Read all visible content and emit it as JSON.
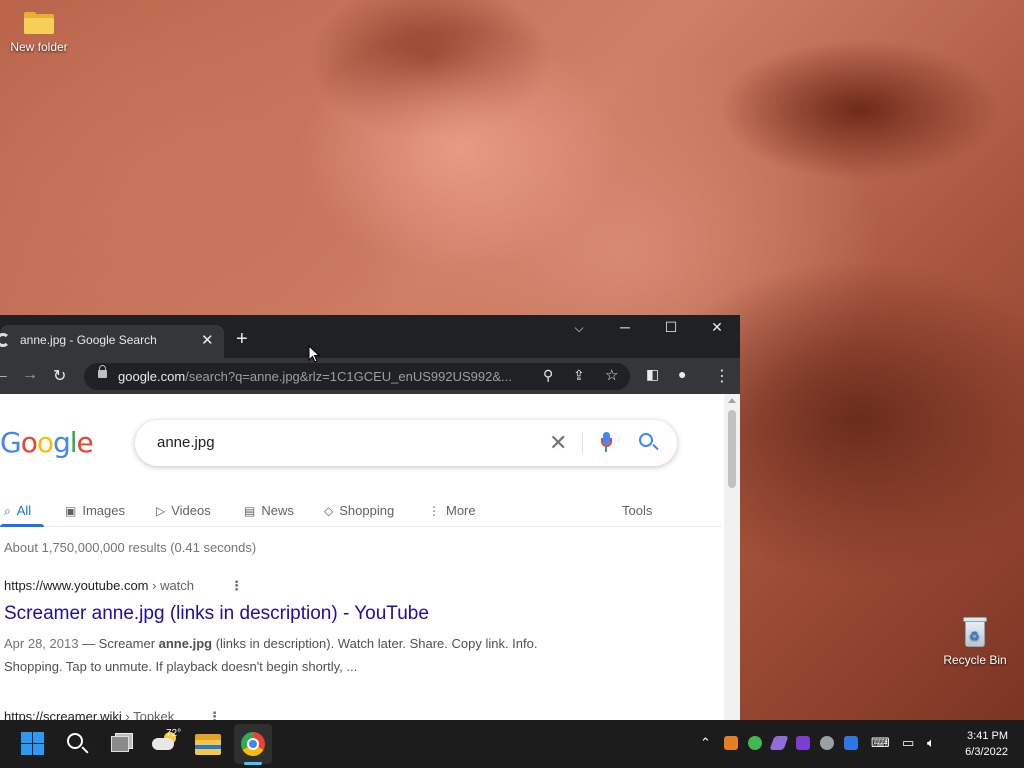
{
  "desktop": {
    "icons": [
      {
        "label": "New folder"
      },
      {
        "label": "Recycle Bin"
      }
    ]
  },
  "browser": {
    "tab_title": "anne.jpg - Google Search",
    "url_host": "google.com",
    "url_path": "/search?q=anne.jpg&rlz=1C1GCEU_enUS992US992&...",
    "page": {
      "logo": "Google",
      "query": "anne.jpg",
      "nav": {
        "all": "All",
        "images": "Images",
        "videos": "Videos",
        "news": "News",
        "shopping": "Shopping",
        "more": "More",
        "tools": "Tools"
      },
      "stats": "About 1,750,000,000 results (0.41 seconds)",
      "results": [
        {
          "site": "https://www.youtube.com",
          "crumb": " › watch",
          "title": "Screamer anne.jpg (links in description) - YouTube",
          "date": "Apr 28, 2013",
          "snippet_a": " — Screamer ",
          "snippet_bold": "anne.jpg",
          "snippet_b": " (links in description). Watch later. Share. Copy link. Info.",
          "snippet_line2": "Shopping. Tap to unmute. If playback doesn't begin shortly, ..."
        },
        {
          "site": "https://screamer.wiki",
          "crumb": " › Topkek"
        }
      ]
    }
  },
  "taskbar": {
    "weather_temp": "72°",
    "clock_time": "3:41 PM",
    "clock_date": "6/3/2022"
  },
  "colors": {
    "google_blue": "#4285f4",
    "google_red": "#ea4335",
    "google_yellow": "#fbbc05",
    "google_green": "#34a853",
    "link": "#1a0dab",
    "accent": "#1a73e8"
  }
}
